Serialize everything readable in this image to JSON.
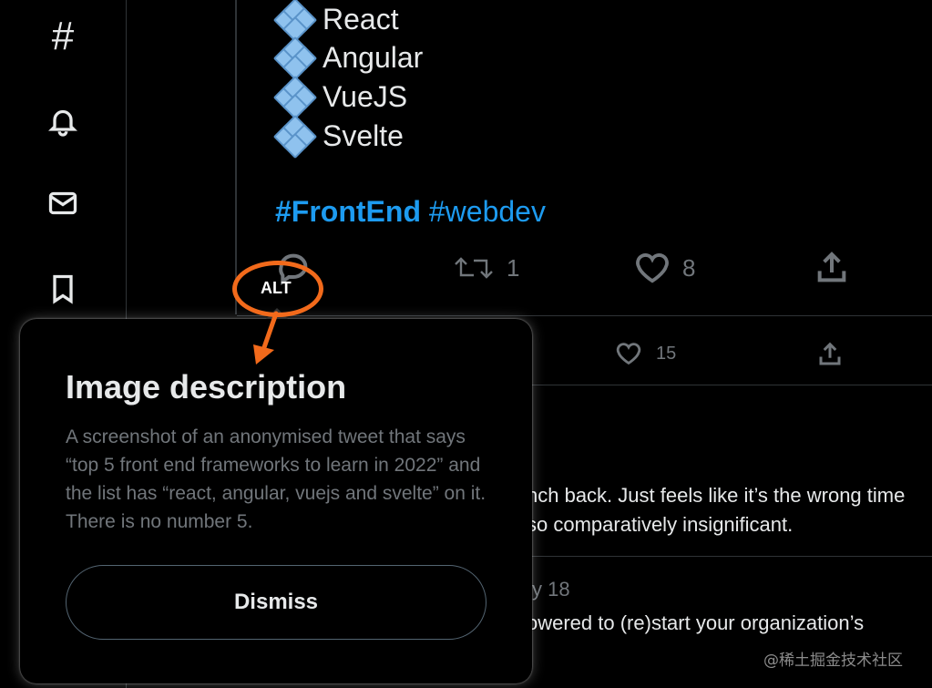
{
  "sidebar": {
    "icons": [
      "hashtag-icon",
      "bell-icon",
      "mail-icon",
      "bookmark-icon"
    ],
    "hash_glyph": "#"
  },
  "tweet": {
    "list": [
      "React",
      "Angular",
      "VueJS",
      "Svelte"
    ],
    "hashtag_bold": "#FrontEnd",
    "hashtag_regular": "#webdev",
    "retweets": "1",
    "likes": "8"
  },
  "tweet2": {
    "likes": "15"
  },
  "tweet3": {
    "line1": "nch back. Just feels like it’s the wrong time",
    "line2": "so comparatively insignificant."
  },
  "tweet4": {
    "date": "y 18",
    "line1": "owered to (re)start your organization’s"
  },
  "annotation": {
    "alt_label": "ALT",
    "accent": "#f26a1b"
  },
  "popup": {
    "title": "Image description",
    "body": "A screenshot of an anonymised tweet that says “top 5 front end frameworks to learn in 2022” and the list has “react, angular, vuejs and svelte” on it. There is no number 5.",
    "dismiss_label": "Dismiss"
  },
  "watermark": "@稀土掘金技术社区",
  "colors": {
    "link": "#1d9bf0",
    "muted": "#71767b",
    "text": "#e7e9ea"
  }
}
